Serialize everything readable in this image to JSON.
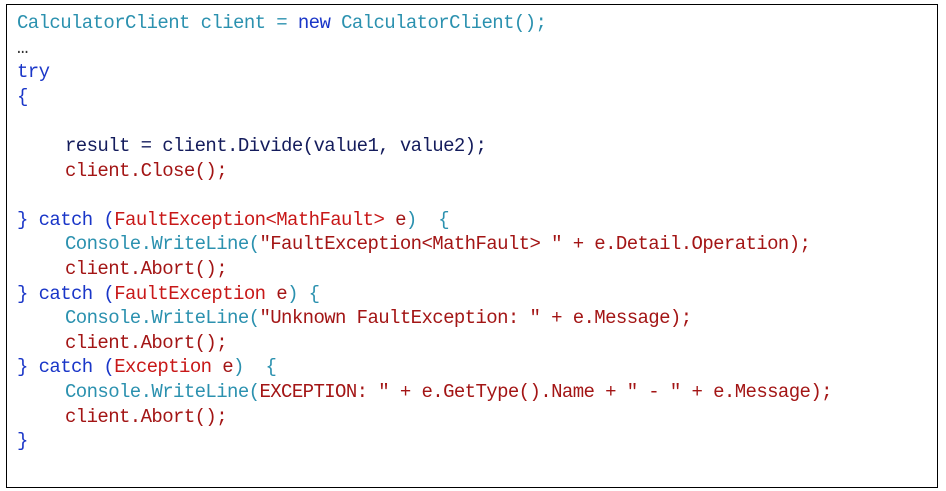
{
  "colors": {
    "blue": "#1a36c8",
    "teal": "#2b91af",
    "red": "#a31515",
    "brightred": "#c81818",
    "navy": "#141c5c",
    "gray": "#303030"
  },
  "code": {
    "lines": [
      {
        "indent": 0,
        "tokens": [
          {
            "text": "CalculatorClient client = ",
            "c": "teal"
          },
          {
            "text": "new",
            "c": "blue"
          },
          {
            "text": " CalculatorClient();",
            "c": "teal"
          }
        ]
      },
      {
        "indent": 0,
        "tokens": [
          {
            "text": "…",
            "c": "gray"
          }
        ]
      },
      {
        "indent": 0,
        "tokens": [
          {
            "text": "try",
            "c": "blue"
          }
        ]
      },
      {
        "indent": 0,
        "tokens": [
          {
            "text": "{",
            "c": "blue"
          }
        ]
      },
      {
        "indent": 0,
        "tokens": []
      },
      {
        "indent": 1,
        "tokens": [
          {
            "text": "result = client.Divide(value1, value2);",
            "c": "navy"
          }
        ]
      },
      {
        "indent": 1,
        "tokens": [
          {
            "text": "client.Close();",
            "c": "red"
          }
        ]
      },
      {
        "indent": 0,
        "tokens": []
      },
      {
        "indent": 0,
        "tokens": [
          {
            "text": "} catch (",
            "c": "blue"
          },
          {
            "text": "FaultException<MathFault>",
            "c": "brightred"
          },
          {
            "text": " e",
            "c": "red"
          },
          {
            "text": ")  {",
            "c": "teal"
          }
        ]
      },
      {
        "indent": 1,
        "tokens": [
          {
            "text": "Console.WriteLine(",
            "c": "teal"
          },
          {
            "text": "\"FaultException<MathFault> \" + e.Detail.Operation);",
            "c": "red"
          }
        ]
      },
      {
        "indent": 1,
        "tokens": [
          {
            "text": "client.Abort();",
            "c": "red"
          }
        ]
      },
      {
        "indent": 0,
        "tokens": [
          {
            "text": "} catch (",
            "c": "blue"
          },
          {
            "text": "FaultException",
            "c": "brightred"
          },
          {
            "text": " e",
            "c": "red"
          },
          {
            "text": ") {",
            "c": "teal"
          }
        ]
      },
      {
        "indent": 1,
        "tokens": [
          {
            "text": "Console.WriteLine(",
            "c": "teal"
          },
          {
            "text": "\"Unknown FaultException: \" + e.Message);",
            "c": "red"
          }
        ]
      },
      {
        "indent": 1,
        "tokens": [
          {
            "text": "client.Abort();",
            "c": "red"
          }
        ]
      },
      {
        "indent": 0,
        "tokens": [
          {
            "text": "} catch (",
            "c": "blue"
          },
          {
            "text": "Exception",
            "c": "brightred"
          },
          {
            "text": " e",
            "c": "red"
          },
          {
            "text": ")  {",
            "c": "teal"
          }
        ]
      },
      {
        "indent": 1,
        "tokens": [
          {
            "text": "Console.WriteLine(",
            "c": "teal"
          },
          {
            "text": "EXCEPTION: \" + e.GetType().Name + \" - \" + e.Message);",
            "c": "red"
          }
        ]
      },
      {
        "indent": 1,
        "tokens": [
          {
            "text": "client.Abort();",
            "c": "red"
          }
        ]
      },
      {
        "indent": 0,
        "tokens": [
          {
            "text": "}",
            "c": "blue"
          }
        ]
      }
    ]
  }
}
